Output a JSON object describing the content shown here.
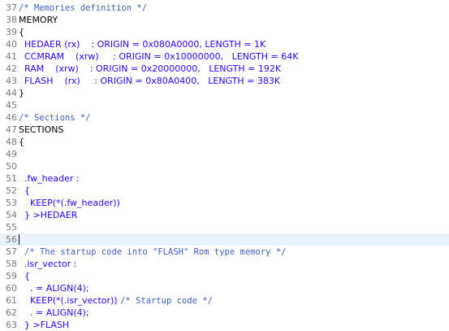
{
  "editor": {
    "lines": [
      {
        "n": "37",
        "segs": [
          {
            "t": "/* Memories definition */",
            "c": "comment"
          }
        ]
      },
      {
        "n": "38",
        "segs": [
          {
            "t": "MEMORY",
            "c": "plain"
          }
        ]
      },
      {
        "n": "39",
        "segs": [
          {
            "t": "{",
            "c": "plain"
          }
        ]
      },
      {
        "n": "40",
        "segs": [
          {
            "t": "  HEDAER (rx)    : ORIGIN = 0x080A0000, LENGTH = 1K",
            "c": "blue"
          }
        ]
      },
      {
        "n": "41",
        "segs": [
          {
            "t": "  CCMRAM    (xrw)     : ORIGIN = 0x10000000,   LENGTH = 64K",
            "c": "blue"
          }
        ]
      },
      {
        "n": "42",
        "segs": [
          {
            "t": "  RAM    (xrw)    : ORIGIN = 0x20000000,   LENGTH = 192K",
            "c": "blue"
          }
        ]
      },
      {
        "n": "43",
        "segs": [
          {
            "t": "  FLASH    (rx)     : ORIGIN = 0x80A0400,   LENGTH = 383K",
            "c": "blue"
          }
        ]
      },
      {
        "n": "44",
        "segs": [
          {
            "t": "}",
            "c": "plain"
          }
        ]
      },
      {
        "n": "45",
        "segs": []
      },
      {
        "n": "46",
        "segs": [
          {
            "t": "/* Sections */",
            "c": "comment"
          }
        ]
      },
      {
        "n": "47",
        "segs": [
          {
            "t": "SECTIONS",
            "c": "plain"
          }
        ]
      },
      {
        "n": "48",
        "segs": [
          {
            "t": "{",
            "c": "plain"
          }
        ]
      },
      {
        "n": "49",
        "segs": []
      },
      {
        "n": "50",
        "segs": []
      },
      {
        "n": "51",
        "segs": [
          {
            "t": "  .fw_header :",
            "c": "blue"
          }
        ]
      },
      {
        "n": "52",
        "segs": [
          {
            "t": "  {",
            "c": "blue"
          }
        ]
      },
      {
        "n": "53",
        "segs": [
          {
            "t": "    KEEP(*(.fw_header))",
            "c": "blue"
          }
        ]
      },
      {
        "n": "54",
        "segs": [
          {
            "t": "  } >HEDAER",
            "c": "blue"
          }
        ]
      },
      {
        "n": "55",
        "segs": []
      },
      {
        "n": "56",
        "segs": [],
        "current": true
      },
      {
        "n": "57",
        "segs": [
          {
            "t": "  ",
            "c": "plain"
          },
          {
            "t": "/* The startup code into \"FLASH\" Rom type memory */",
            "c": "comment"
          }
        ]
      },
      {
        "n": "58",
        "segs": [
          {
            "t": "  .isr_vector :",
            "c": "blue"
          }
        ]
      },
      {
        "n": "59",
        "segs": [
          {
            "t": "  {",
            "c": "blue"
          }
        ]
      },
      {
        "n": "60",
        "segs": [
          {
            "t": "    . = ALIGN(4);",
            "c": "blue"
          }
        ]
      },
      {
        "n": "61",
        "segs": [
          {
            "t": "    KEEP(*(.isr_vector)) ",
            "c": "blue"
          },
          {
            "t": "/* Startup code */",
            "c": "comment"
          }
        ]
      },
      {
        "n": "62",
        "segs": [
          {
            "t": "    . = ALIGN(4);",
            "c": "blue"
          }
        ]
      },
      {
        "n": "63",
        "segs": [
          {
            "t": "  } >FLASH",
            "c": "blue"
          }
        ]
      }
    ]
  }
}
